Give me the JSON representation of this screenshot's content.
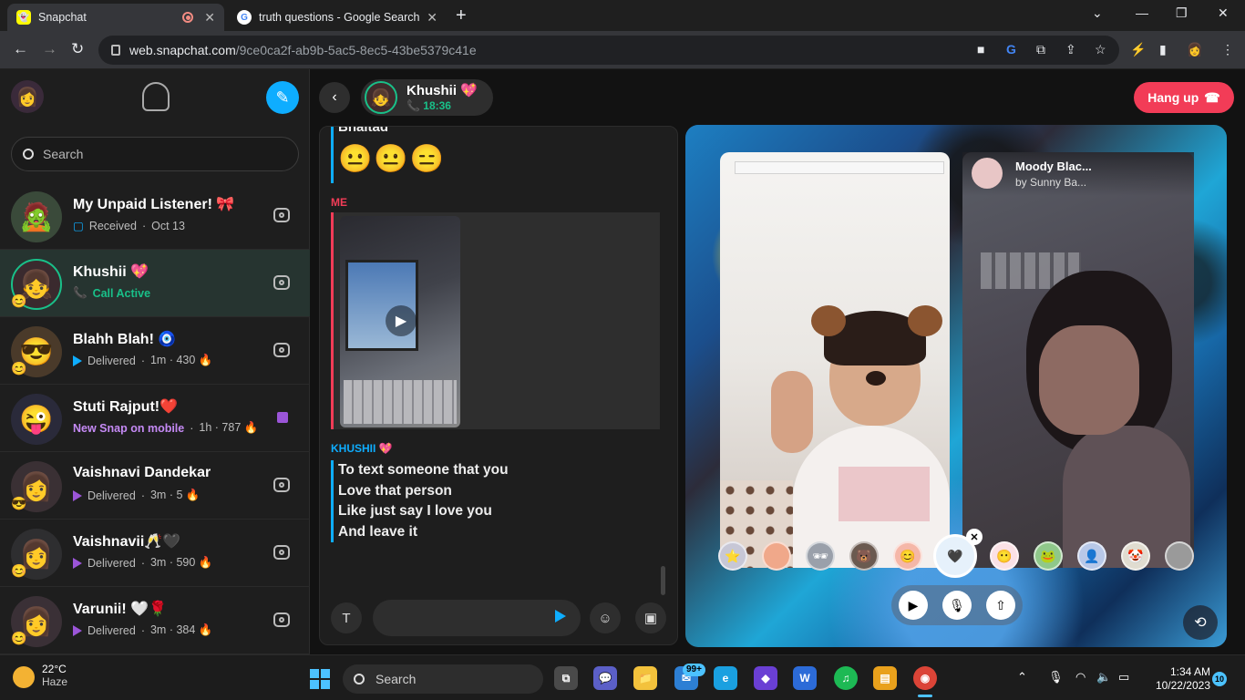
{
  "browser": {
    "tabs": [
      {
        "title": "Snapchat",
        "favicon": "snapchat-icon"
      },
      {
        "title": "truth questions - Google Search",
        "favicon": "google-icon"
      }
    ],
    "url_host": "web.snapchat.com",
    "url_path": "/9ce0ca2f-ab9b-5ac5-8ec5-43be5379c41e"
  },
  "sidebar": {
    "search_placeholder": "Search",
    "chats": [
      {
        "name": "My Unpaid Listener! 🎀",
        "status": "Received",
        "meta": "Oct 13",
        "avatar": "🧟",
        "kind": "received"
      },
      {
        "name": "Khushii 💖",
        "status": "Call Active",
        "meta": "",
        "avatar": "👧",
        "kind": "call",
        "badge": "😊"
      },
      {
        "name": "Blahh Blah! 🧿",
        "status": "Delivered",
        "meta": "1m · 430 🔥",
        "avatar": "😎",
        "kind": "delivered-blue",
        "badge": "😊"
      },
      {
        "name": "Stuti Rajput!❤️",
        "status": "New Snap on mobile",
        "meta": "1h · 787 🔥",
        "avatar": "😜",
        "kind": "new-snap"
      },
      {
        "name": "Vaishnavi Dandekar",
        "status": "Delivered",
        "meta": "3m · 5 🔥",
        "avatar": "👩",
        "kind": "delivered-purple",
        "badge": "😎"
      },
      {
        "name": "Vaishnavii🥂🖤",
        "status": "Delivered",
        "meta": "3m · 590 🔥",
        "avatar": "👩",
        "kind": "delivered-purple",
        "badge": "😊"
      },
      {
        "name": "Varunii! 🤍🌹",
        "status": "Delivered",
        "meta": "3m · 384 🔥",
        "avatar": "👩",
        "kind": "delivered-purple",
        "badge": "😊"
      }
    ]
  },
  "chat_header": {
    "friend_name": "Khushii 💖",
    "call_time": "18:36",
    "hangup_label": "Hang up"
  },
  "messages": {
    "prev_sender_text": "Bhaltad",
    "emojis": "😐😐😑",
    "me_label": "ME",
    "friend_label": "KHUSHII 💖",
    "friend_lines": [
      "To text someone that you",
      "Love that person",
      "Like just say I love you",
      "And leave it"
    ],
    "input_value": ""
  },
  "call": {
    "lens_name": "Moody Blac...",
    "lens_by": "by Sunny Ba..."
  },
  "taskbar": {
    "temp": "22°C",
    "weather": "Haze",
    "search_label": "Search",
    "mail_badge": "99+",
    "time": "1:34 AM",
    "date": "10/22/2023",
    "notifications": "10"
  },
  "colors": {
    "accent_blue": "#0eadff",
    "hangup_red": "#f23c57",
    "call_green": "#19c089",
    "snap_purple": "#9b55d8"
  }
}
